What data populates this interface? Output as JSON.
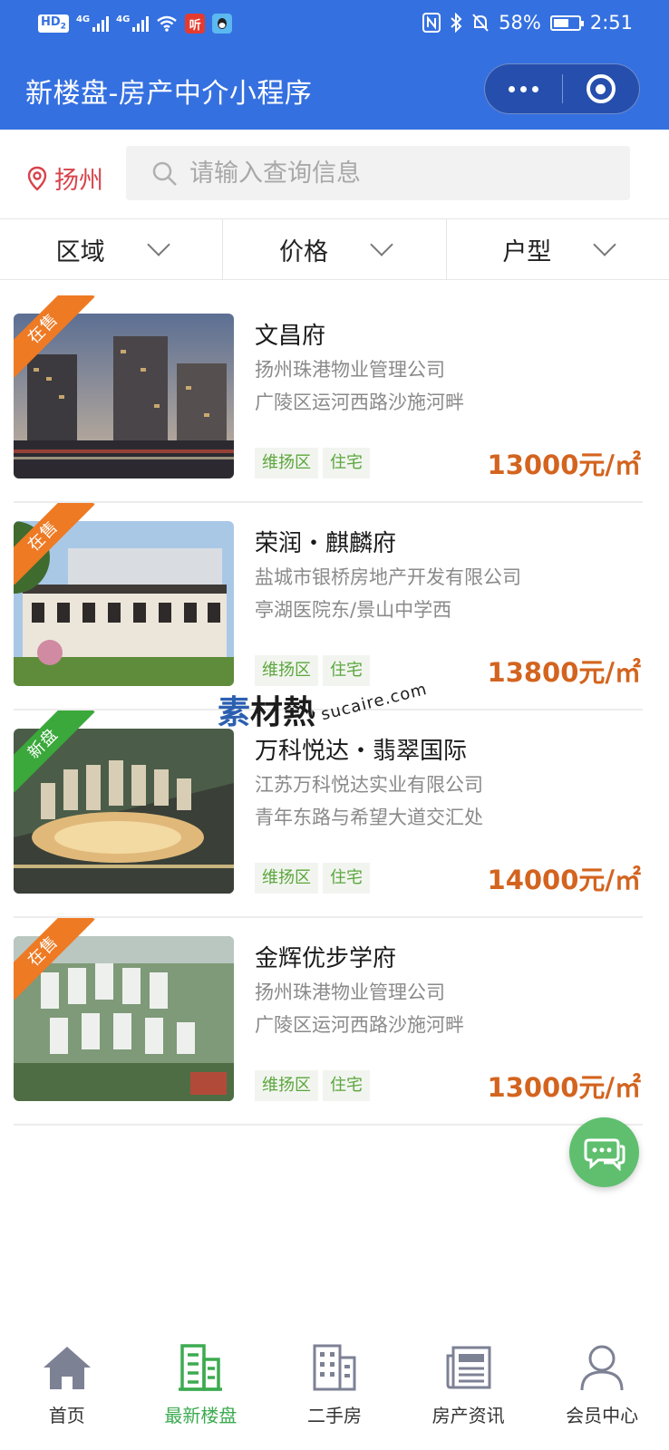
{
  "status_bar": {
    "hd_label": "HD",
    "hd_sub": "2",
    "signal1_label": "4G",
    "signal2_label": "4G",
    "app_icon_label": "听",
    "battery_percent": "58%",
    "time": "2:51"
  },
  "nav": {
    "title": "新楼盘-房产中介小程序"
  },
  "search": {
    "city": "扬州",
    "placeholder": "请输入查询信息"
  },
  "filters": [
    {
      "label": "区域"
    },
    {
      "label": "价格"
    },
    {
      "label": "户型"
    }
  ],
  "listings": [
    {
      "badge": "在售",
      "badge_color": "#ee7a24",
      "name": "文昌府",
      "company": "扬州珠港物业管理公司",
      "address": "广陵区运河西路沙施河畔",
      "tags": [
        "维扬区",
        "住宅"
      ],
      "price": "13000元/㎡"
    },
    {
      "badge": "在售",
      "badge_color": "#ee7a24",
      "name": "荣润・麒麟府",
      "company": "盐城市银桥房地产开发有限公司",
      "address": "亭湖医院东/景山中学西",
      "tags": [
        "维扬区",
        "住宅"
      ],
      "price": "13800元/㎡"
    },
    {
      "badge": "新盘",
      "badge_color": "#3aa83a",
      "name": "万科悦达・翡翠国际",
      "company": "江苏万科悦达实业有限公司",
      "address": "青年东路与希望大道交汇处",
      "tags": [
        "维扬区",
        "住宅"
      ],
      "price": "14000元/㎡"
    },
    {
      "badge": "在售",
      "badge_color": "#ee7a24",
      "name": "金辉优步学府",
      "company": "扬州珠港物业管理公司",
      "address": "广陵区运河西路沙施河畔",
      "tags": [
        "维扬区",
        "住宅"
      ],
      "price": "13000元/㎡"
    }
  ],
  "watermark": {
    "first_char": "素",
    "rest": "材熱",
    "domain": "sucaire.com"
  },
  "tabbar": [
    {
      "label": "首页",
      "icon": "home-icon",
      "active": false
    },
    {
      "label": "最新楼盘",
      "icon": "building-icon",
      "active": true
    },
    {
      "label": "二手房",
      "icon": "apartment-icon",
      "active": false
    },
    {
      "label": "房产资讯",
      "icon": "newspaper-icon",
      "active": false
    },
    {
      "label": "会员中心",
      "icon": "user-icon",
      "active": false
    }
  ],
  "colors": {
    "primary": "#3570e0",
    "price": "#d3641f",
    "tag_text": "#5aa63c",
    "active_tab": "#3cab50",
    "chat_fab": "#5fbf6e",
    "city": "#d8434b"
  }
}
